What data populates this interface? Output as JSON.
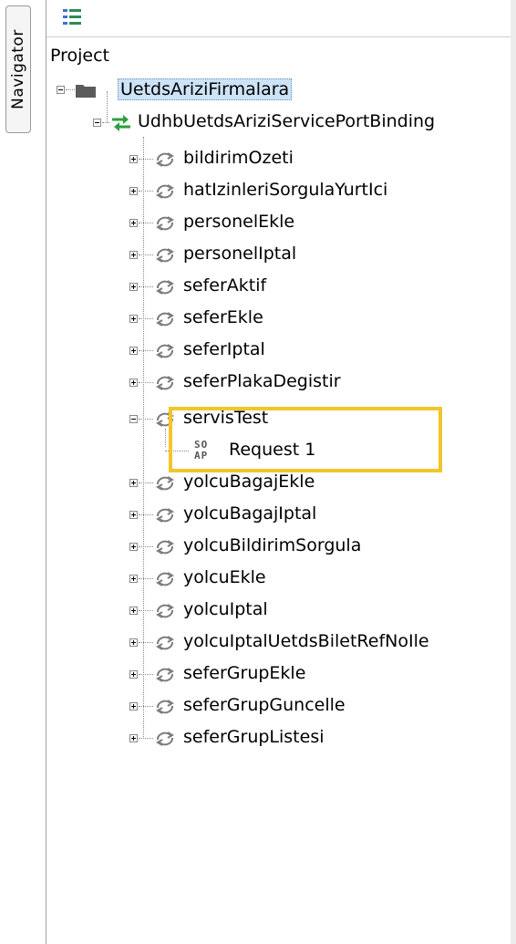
{
  "sidebar": {
    "tab_label": "Navigator"
  },
  "toolbar": {
    "icon": "tree-list-icon"
  },
  "tree": {
    "root_label": "Project",
    "project": {
      "label": "UetdsAriziFirmalara",
      "icon": "folder-icon"
    },
    "binding": {
      "label": "UdhbUetdsAriziServicePortBinding",
      "icon": "binding-arrows-icon"
    },
    "operations": [
      "bildirimOzeti",
      "hatIzinleriSorgulaYurtIci",
      "personelEkle",
      "personelIptal",
      "seferAktif",
      "seferEkle",
      "seferIptal",
      "seferPlakaDegistir",
      "servisTest",
      "yolcuBagajEkle",
      "yolcuBagajIptal",
      "yolcuBildirimSorgula",
      "yolcuEkle",
      "yolcuIptal",
      "yolcuIptalUetdsBiletRefNoIle",
      "seferGrupEkle",
      "seferGrupGuncelle",
      "seferGrupListesi"
    ],
    "expanded_operation": "servisTest",
    "request": {
      "label": "Request 1",
      "icon_text_top": "SO",
      "icon_text_bottom": "AP"
    }
  },
  "colors": {
    "highlight": "#f2c52a",
    "selection": "#cde3f7",
    "binding_green": "#2e9e3e"
  }
}
